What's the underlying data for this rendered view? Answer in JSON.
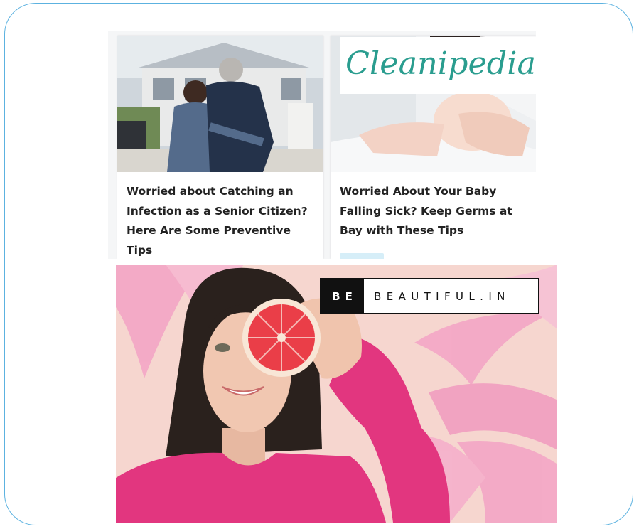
{
  "cleanipedia": {
    "logo_text": "Cleanipedia",
    "brand_color": "#2a9d8f",
    "cards": [
      {
        "headline": "Worried about Catching an Infection as a Senior Citizen? Here Are Some Preventive Tips"
      },
      {
        "headline": "Worried About Your Baby Falling Sick? Keep Germs at Bay with These Tips"
      }
    ]
  },
  "bebeautiful": {
    "logo_mark": "BE",
    "logo_text": "BEAUTIFUL.IN",
    "accent_color": "#e2367f",
    "background_color": "#f6d6cf"
  },
  "colors": {
    "frame_border": "#5cb2e0",
    "headline_text": "#222222"
  }
}
